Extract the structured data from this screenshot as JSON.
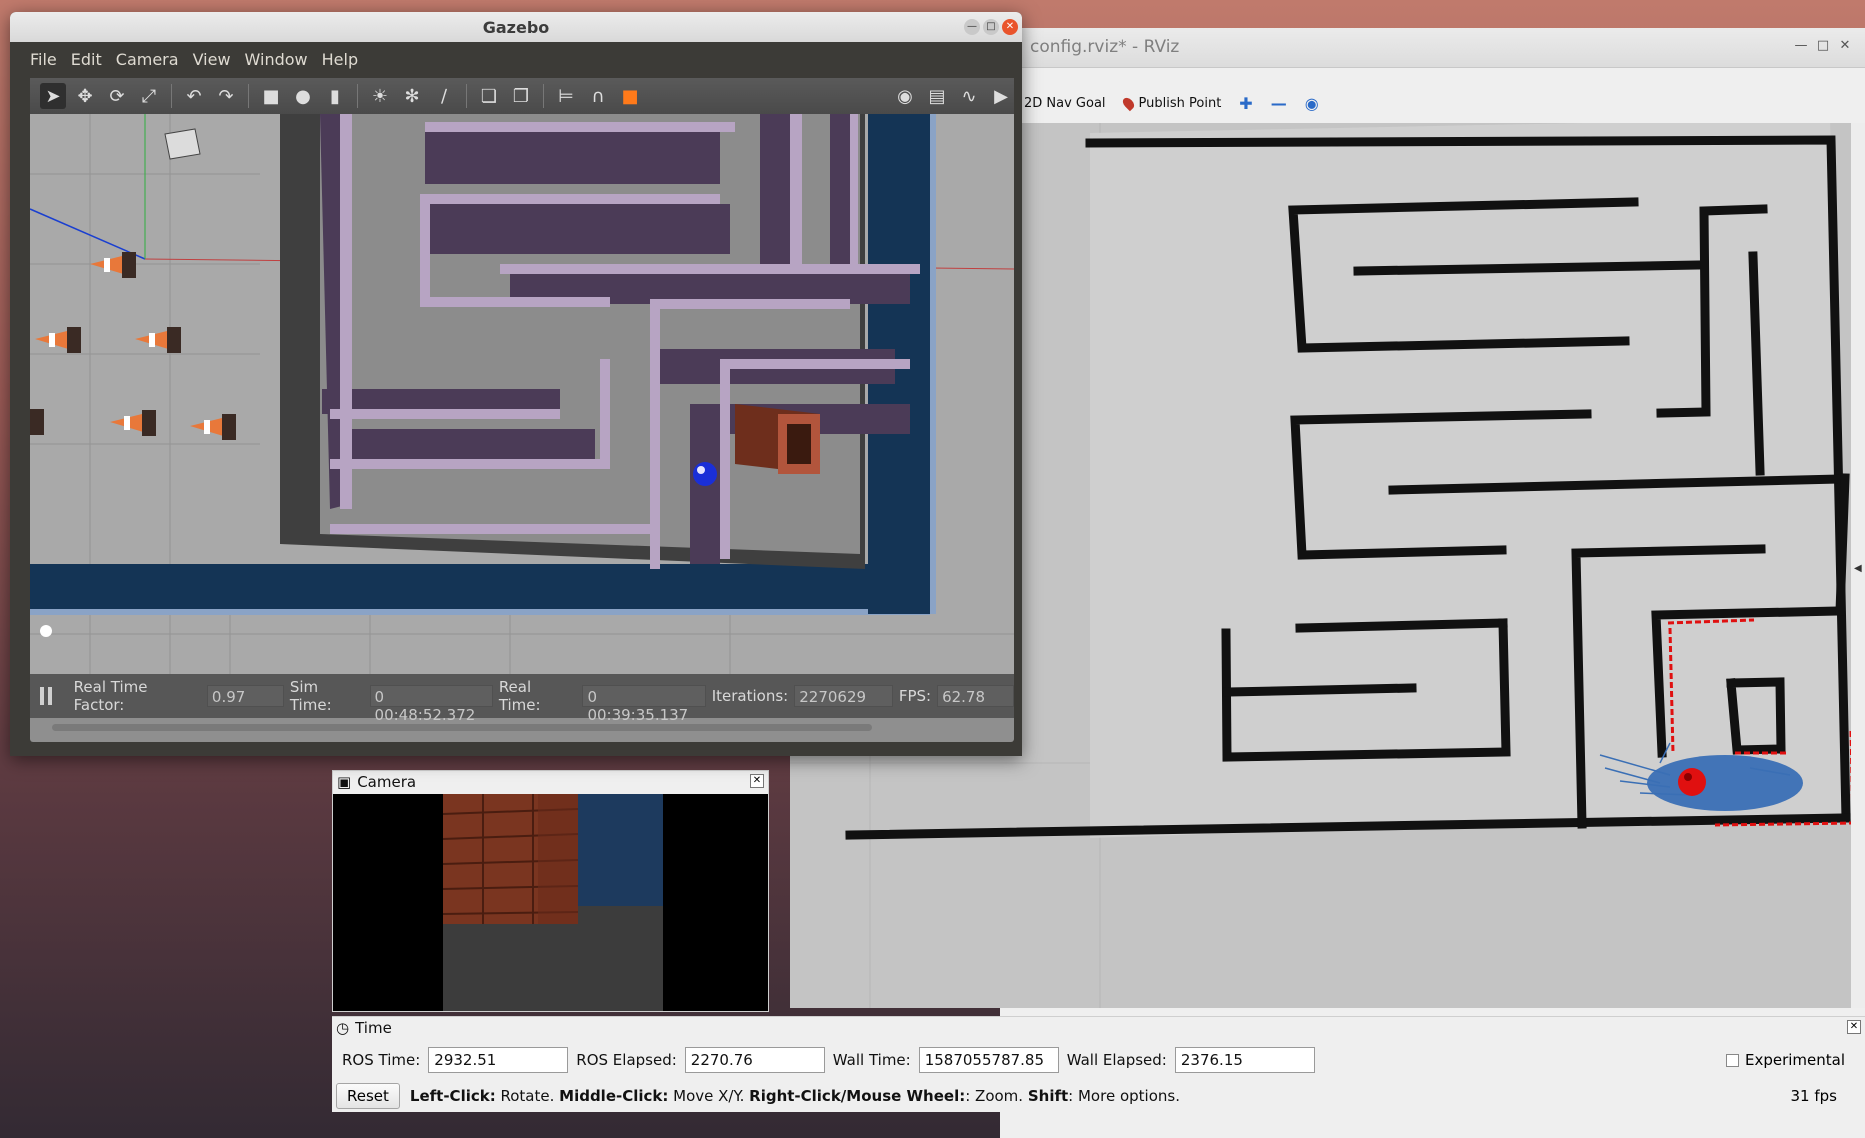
{
  "gazebo": {
    "title": "Gazebo",
    "menu": [
      "File",
      "Edit",
      "Camera",
      "View",
      "Window",
      "Help"
    ],
    "status": {
      "rtf_label": "Real Time Factor:",
      "rtf_value": "0.97",
      "sim_time_label": "Sim Time:",
      "sim_time_value": "0 00:48:52.372",
      "real_time_label": "Real Time:",
      "real_time_value": "0 00:39:35.137",
      "iterations_label": "Iterations:",
      "iterations_value": "2270629",
      "fps_label": "FPS:",
      "fps_value": "62.78"
    },
    "toolbar_icons": [
      "select-icon",
      "translate-icon",
      "rotate-icon",
      "scale-icon",
      "undo-icon",
      "redo-icon",
      "box-icon",
      "sphere-icon",
      "cylinder-icon",
      "point-light-icon",
      "spot-light-icon",
      "directional-light-icon",
      "copy-icon",
      "paste-icon",
      "align-icon",
      "snap-icon",
      "color-icon",
      "screenshot-icon",
      "log-icon",
      "plot-icon",
      "record-icon"
    ]
  },
  "rviz": {
    "title": "config.rviz* - RViz",
    "toolbar": {
      "nav_goal": "2D Nav Goal",
      "publish_point": "Publish Point"
    },
    "camera_panel": {
      "title": "Camera"
    },
    "time_panel": {
      "title": "Time",
      "ros_time_label": "ROS Time:",
      "ros_time_value": "2932.51",
      "ros_elapsed_label": "ROS Elapsed:",
      "ros_elapsed_value": "2270.76",
      "wall_time_label": "Wall Time:",
      "wall_time_value": "1587055787.85",
      "wall_elapsed_label": "Wall Elapsed:",
      "wall_elapsed_value": "2376.15",
      "experimental_label": "Experimental"
    },
    "hint": {
      "reset": "Reset",
      "left_click": "Left-Click:",
      "left_click_desc": " Rotate. ",
      "middle_click": "Middle-Click:",
      "middle_click_desc": " Move X/Y. ",
      "right_click": "Right-Click/Mouse Wheel:",
      "right_click_desc": ": Zoom. ",
      "shift": "Shift",
      "shift_desc": ": More options."
    },
    "fps": "31 fps"
  },
  "colors": {
    "wall": "#111111",
    "laser": "#e01010",
    "particles": "#3a6fb5",
    "robot": "#e01010",
    "gazebo_wall": "#4a3a55"
  }
}
